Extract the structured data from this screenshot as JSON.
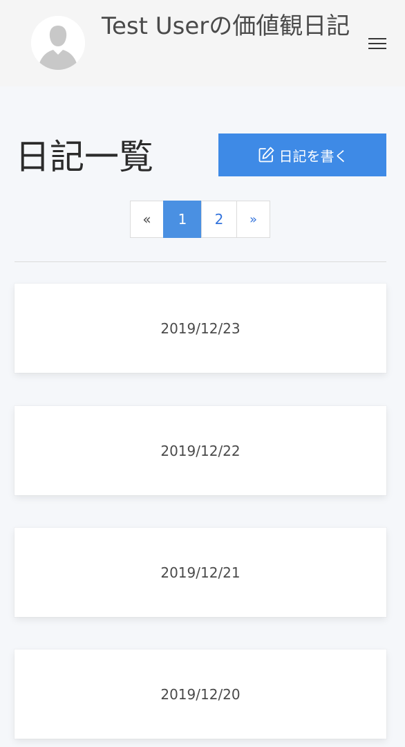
{
  "navbar": {
    "title": "Test Userの価値観日記",
    "avatar_icon": "user-avatar-icon",
    "menu_icon": "hamburger-menu-icon"
  },
  "main": {
    "page_title": "日記一覧",
    "write_button": {
      "label": "日記を書く",
      "icon": "edit-icon"
    },
    "pagination": {
      "prev": "«",
      "pages": [
        "1",
        "2"
      ],
      "current": "1",
      "next": "»"
    },
    "entries": [
      {
        "date": "2019/12/23"
      },
      {
        "date": "2019/12/22"
      },
      {
        "date": "2019/12/21"
      },
      {
        "date": "2019/12/20"
      }
    ]
  },
  "colors": {
    "primary": "#3e8ae6",
    "active_page": "#4a90e2",
    "link": "#3273dc",
    "background": "#f5f7fa"
  }
}
